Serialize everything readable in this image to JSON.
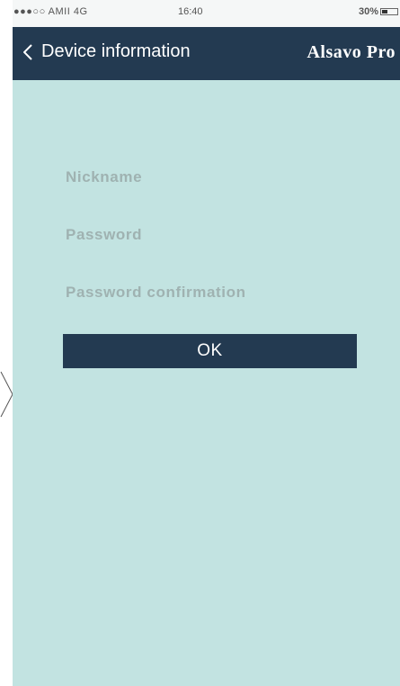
{
  "status_bar": {
    "carrier": "●●●○○ AMII 4G",
    "time": "16:40",
    "battery": "30%"
  },
  "nav": {
    "title": "Device information",
    "brand": "Alsavo Pro"
  },
  "form": {
    "nickname_placeholder": "Nickname",
    "password_placeholder": "Password",
    "password_confirmation_placeholder": "Password confirmation",
    "ok_label": "OK"
  },
  "colors": {
    "header_bg": "#233a51",
    "screen_bg": "#c2e3e1",
    "button_bg": "#233a51",
    "placeholder_text": "#9fb2b1"
  },
  "icons": {
    "back": "chevron-left-icon",
    "battery": "battery-icon",
    "side_arrow": "chevron-right-icon"
  }
}
